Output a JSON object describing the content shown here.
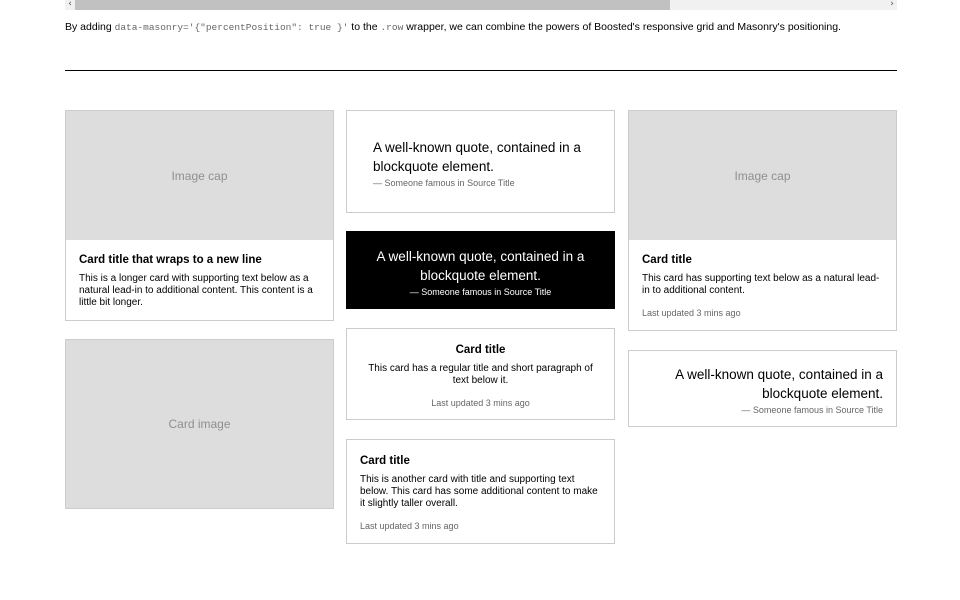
{
  "scrollbar": {
    "left_arrow": "‹",
    "right_arrow": "›"
  },
  "intro": {
    "text_before": "By adding ",
    "code_attr": "data-masonry='{\"percentPosition\": true }'",
    "text_middle": " to the ",
    "code_class": ".row",
    "text_after": " wrapper, we can combine the powers of Boosted's responsive grid and Masonry's positioning."
  },
  "cards": {
    "card1": {
      "image_label": "Image cap",
      "title": "Card title that wraps to a new line",
      "text": "This is a longer card with supporting text below as a natural lead-in to additional content. This content is a little bit longer."
    },
    "card2": {
      "image_label": "Card image"
    },
    "quote1": {
      "quote": "A well-known quote, contained in a blockquote element.",
      "footer_dash": "—",
      "footer": "Someone famous in Source Title"
    },
    "quote2": {
      "quote": "A well-known quote, contained in a blockquote element.",
      "footer_dash": "—",
      "footer": "Someone famous in Source Title"
    },
    "card3": {
      "title": "Card title",
      "text": "This card has a regular title and short paragraph of text below it.",
      "updated": "Last updated 3 mins ago"
    },
    "card4": {
      "title": "Card title",
      "text": "This is another card with title and supporting text below. This card has some additional content to make it slightly taller overall.",
      "updated": "Last updated 3 mins ago"
    },
    "card5": {
      "image_label": "Image cap",
      "title": "Card title",
      "text": "This card has supporting text below as a natural lead-in to additional content.",
      "updated": "Last updated 3 mins ago"
    },
    "quote3": {
      "quote": "A well-known quote, contained in a blockquote element.",
      "footer_dash": "—",
      "footer": "Someone famous in Source Title"
    }
  },
  "colors": {
    "image_placeholder": "#dddddd",
    "card_border": "#cccccc",
    "inverse_card": "#000000",
    "muted_text": "#666666"
  }
}
